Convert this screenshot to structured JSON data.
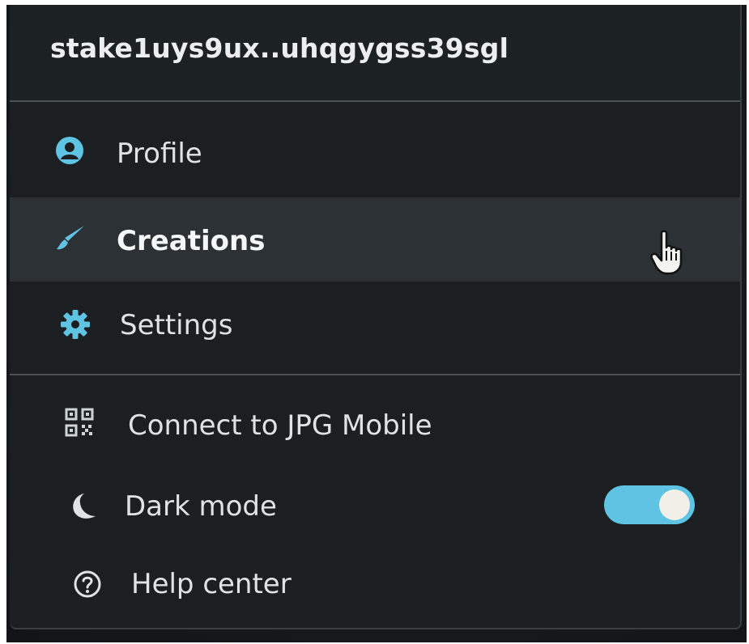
{
  "wallet": {
    "address": "stake1uys9ux..uhqgygss39sgl"
  },
  "menu": {
    "items": [
      {
        "label": "Profile",
        "icon": "user-circle-icon"
      },
      {
        "label": "Creations",
        "icon": "paintbrush-icon",
        "state": "hovered"
      },
      {
        "label": "Settings",
        "icon": "gear-icon"
      }
    ],
    "secondary_items": [
      {
        "label": "Connect to JPG Mobile",
        "icon": "qr-code-icon"
      },
      {
        "label": "Dark mode",
        "icon": "moon-icon",
        "toggle_on": true
      },
      {
        "label": "Help center",
        "icon": "question-circle-icon"
      }
    ]
  },
  "colors": {
    "accent": "#5fc4e4",
    "menu_background": "#1b1f22",
    "hover_background": "#2b3134",
    "text": "#dfe3e5"
  }
}
